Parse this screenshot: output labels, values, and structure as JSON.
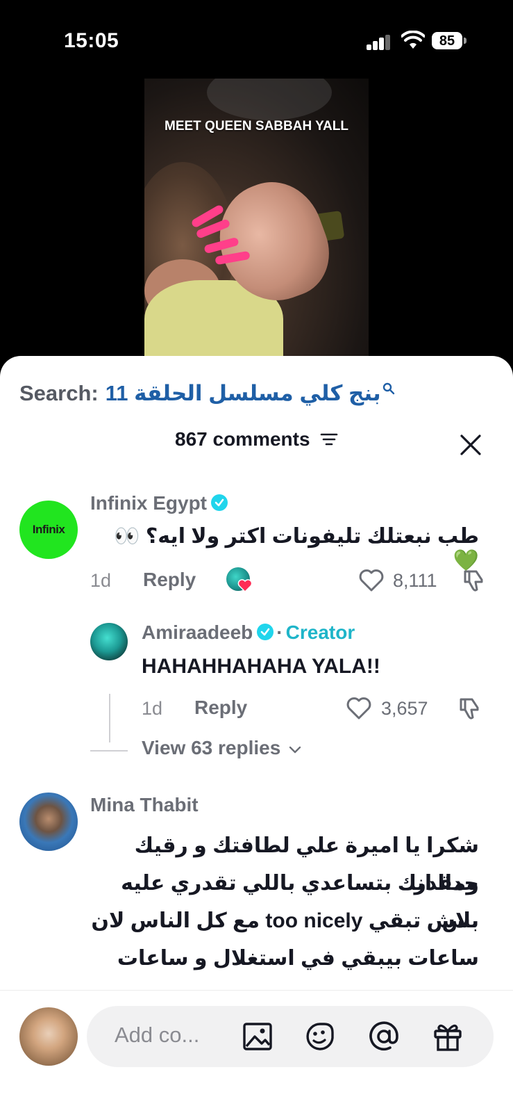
{
  "status_bar": {
    "time": "15:05",
    "battery": "85"
  },
  "video": {
    "caption": "MEET QUEEN SABBAH YALL"
  },
  "search": {
    "prefix": "Search:",
    "query": "بنج كلي مسلسل الحلقة 11"
  },
  "comments_header": {
    "count_label": "867 comments"
  },
  "comments": [
    {
      "author": "Infinix Egypt",
      "avatar_text": "Infinix",
      "text": "طب نبعتلك تليفونات اكتر ولا ايه؟ 👀💚",
      "age": "1d",
      "reply_label": "Reply",
      "likes": "8,111",
      "replies": [
        {
          "author": "Amiraadeeb",
          "separator": "·",
          "tag": "Creator",
          "text": "HAHAHHAHAHA YALA!!",
          "age": "1d",
          "reply_label": "Reply",
          "likes": "3,657"
        }
      ],
      "view_replies_label": "View 63 replies"
    },
    {
      "author": "Mina Thabit",
      "lines": [
        "شكرا يا اميرة علي لطافتك و رقيك ومقدر",
        "جداا انك بتساعدي باللي تقدري عليه بس",
        "بلاش تبقي too nicely مع كل الناس لان",
        "ساعات بيبقي في استغلال و ساعات"
      ]
    }
  ],
  "composer": {
    "placeholder": "Add co..."
  },
  "colors": {
    "verified": "#20d5ec",
    "creator": "#1fb5c9",
    "infinix_green": "#21e51f",
    "search_blue": "#1f5fa6"
  }
}
